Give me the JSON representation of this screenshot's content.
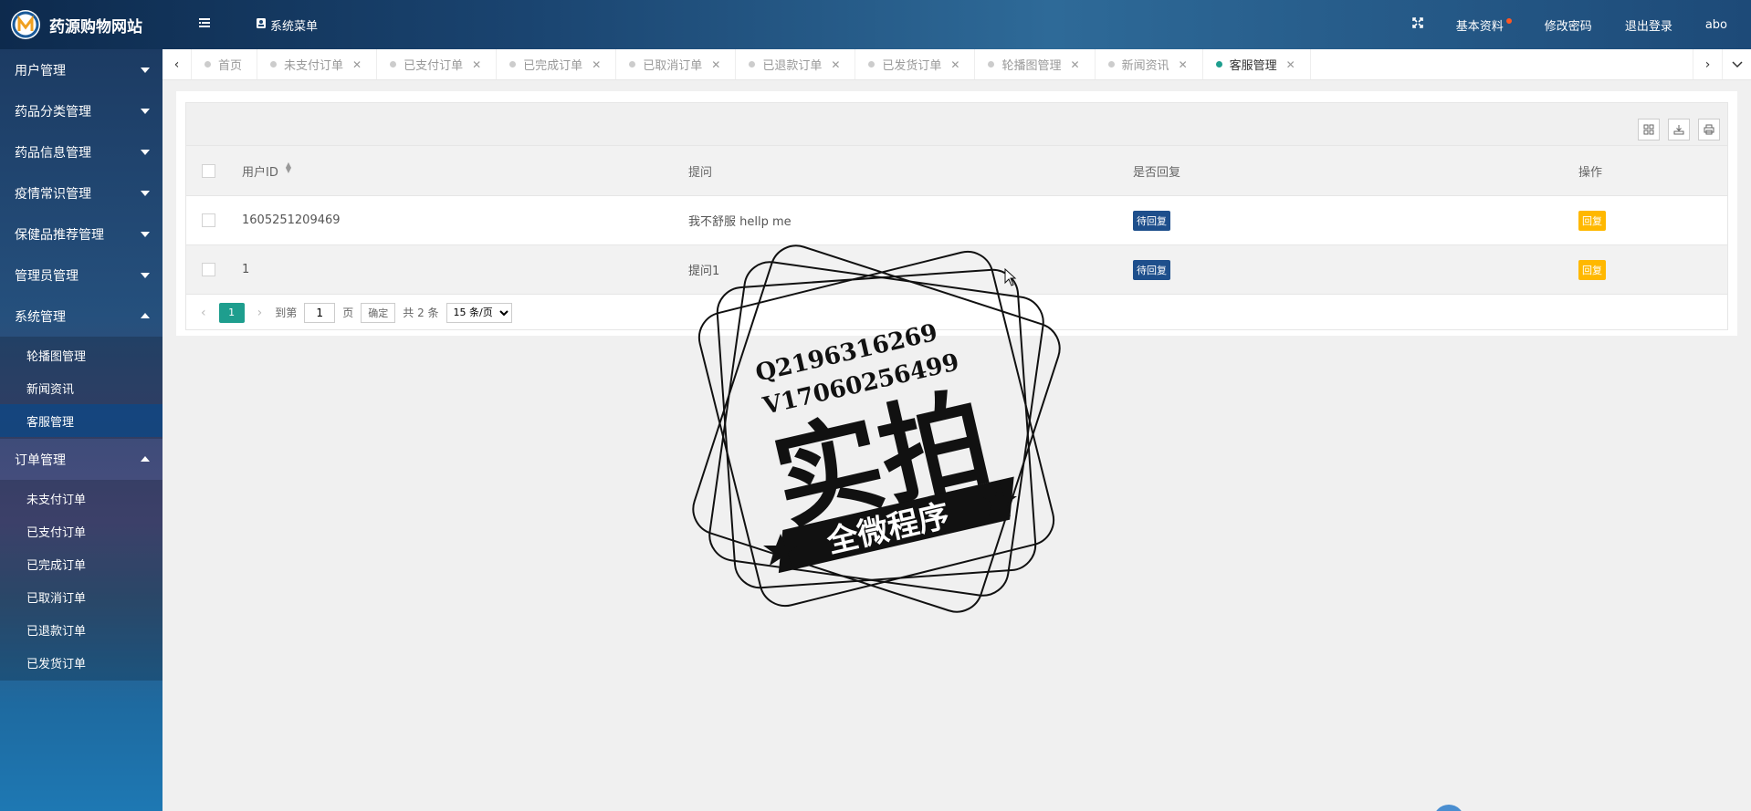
{
  "header": {
    "title": "药源购物网站",
    "system_menu": "系统菜单",
    "profile": "基本资料",
    "change_password": "修改密码",
    "logout": "退出登录",
    "username": "abo"
  },
  "sidebar": {
    "groups": [
      {
        "label": "用户管理",
        "expanded": false
      },
      {
        "label": "药品分类管理",
        "expanded": false
      },
      {
        "label": "药品信息管理",
        "expanded": false
      },
      {
        "label": "疫情常识管理",
        "expanded": false
      },
      {
        "label": "保健品推荐管理",
        "expanded": false
      },
      {
        "label": "管理员管理",
        "expanded": false
      },
      {
        "label": "系统管理",
        "expanded": true,
        "children": [
          "轮播图管理",
          "新闻资讯",
          "客服管理"
        ]
      },
      {
        "label": "订单管理",
        "expanded": true,
        "children": [
          "未支付订单",
          "已支付订单",
          "已完成订单",
          "已取消订单",
          "已退款订单",
          "已发货订单"
        ]
      }
    ],
    "active_item": "客服管理"
  },
  "tabs": [
    "首页",
    "未支付订单",
    "已支付订单",
    "已完成订单",
    "已取消订单",
    "已退款订单",
    "已发货订单",
    "轮播图管理",
    "新闻资讯",
    "客服管理"
  ],
  "active_tab": "客服管理",
  "table": {
    "columns": [
      "用户ID",
      "提问",
      "是否回复",
      "操作"
    ],
    "rows": [
      {
        "user_id": "1605251209469",
        "question": "我不舒服 hellp me",
        "status": "待回复",
        "action": "回复"
      },
      {
        "user_id": "1",
        "question": "提问1",
        "status": "待回复",
        "action": "回复"
      }
    ]
  },
  "pager": {
    "current_page": "1",
    "goto_label": "到第",
    "goto_value": "1",
    "page_unit": "页",
    "confirm": "确定",
    "total": "共 2 条",
    "page_size": "15 条/页"
  },
  "watermark": {
    "line1": "Q2196316269",
    "line2": "V17060256499",
    "big": "实拍",
    "banner": "全微程序"
  },
  "colors": {
    "accent": "#1e9e8e",
    "badge_blue": "#1e4f8c",
    "badge_orange": "#ffb800",
    "active_nav": "#114682"
  }
}
